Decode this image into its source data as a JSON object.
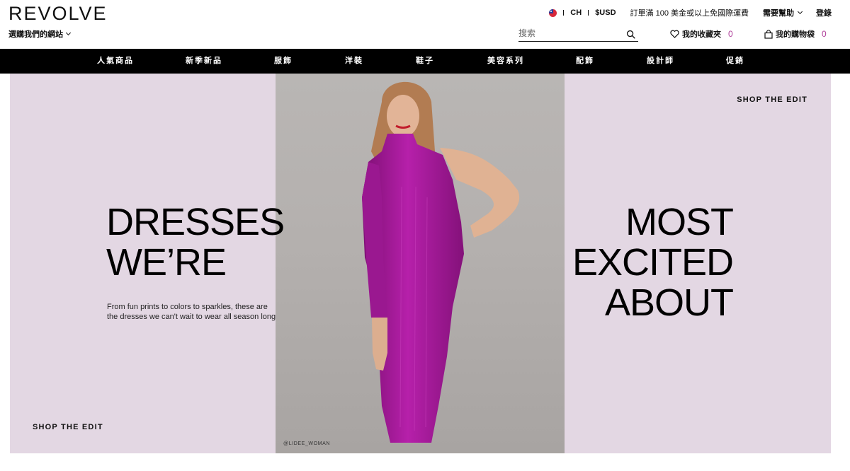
{
  "header": {
    "logo": "REVOLVE",
    "site_select": "選購我們的網站",
    "language": "CH",
    "currency": "$USD",
    "shipping_note": "訂單滿 100 美金或以上免國際運費",
    "help": "需要幫助",
    "login": "登錄",
    "search_placeholder": "搜索",
    "favorites_label": "我的收藏夾",
    "favorites_count": "0",
    "bag_label": "我的購物袋",
    "bag_count": "0"
  },
  "nav": {
    "items": [
      "人氣商品",
      "新季新品",
      "服飾",
      "洋裝",
      "鞋子",
      "美容系列",
      "配飾",
      "設計師",
      "促銷"
    ]
  },
  "hero": {
    "headline_left": [
      "DRESSES",
      "WE’RE"
    ],
    "headline_right": [
      "MOST",
      "EXCITED",
      "ABOUT"
    ],
    "subtext_line1": "From fun prints to colors to sparkles, these are",
    "subtext_line2": "the dresses we can't wait to wear all season long",
    "cta_top": "SHOP THE EDIT",
    "cta_bottom": "SHOP THE EDIT",
    "photo_credit": "@LIDEE_WOMAN",
    "dress_color": "#a8179c",
    "panel_color": "#e3d7e3"
  }
}
